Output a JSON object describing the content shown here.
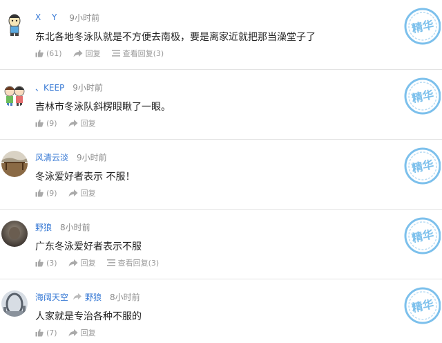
{
  "badge_text": "精华",
  "badge_color": "#7cc0ec",
  "link_color": "#3a7bd5",
  "comments": [
    {
      "user": "X Y",
      "time": "9小时前",
      "text": "东北各地冬泳队就是不方便去南极，要是离家近就把那当澡堂子了",
      "likes": "(61)",
      "reply_label": "回复",
      "view_replies": "查看回复(3)",
      "avatar_icon": "cartoon-boy-avatar"
    },
    {
      "user": "、KEEP",
      "time": "9小时前",
      "text": "吉林市冬泳队斜楞眼瞅了一眼。",
      "likes": "(9)",
      "reply_label": "回复",
      "avatar_icon": "cartoon-couple-avatar"
    },
    {
      "user": "风清云淡",
      "time": "9小时前",
      "text": "冬泳爱好者表示  不服！",
      "likes": "(9)",
      "reply_label": "回复",
      "avatar_icon": "landscape-avatar"
    },
    {
      "user": "野狼",
      "time": "8小时前",
      "text": "广东冬泳爱好者表示不服",
      "likes": "(3)",
      "reply_label": "回复",
      "view_replies": "查看回复(3)",
      "avatar_icon": "dark-photo-avatar"
    },
    {
      "user": "海阔天空",
      "reply_to": "野狼",
      "time": "8小时前",
      "text": "人家就是专治各种不服的",
      "likes": "(7)",
      "reply_label": "回复",
      "avatar_icon": "city-ring-avatar"
    }
  ]
}
